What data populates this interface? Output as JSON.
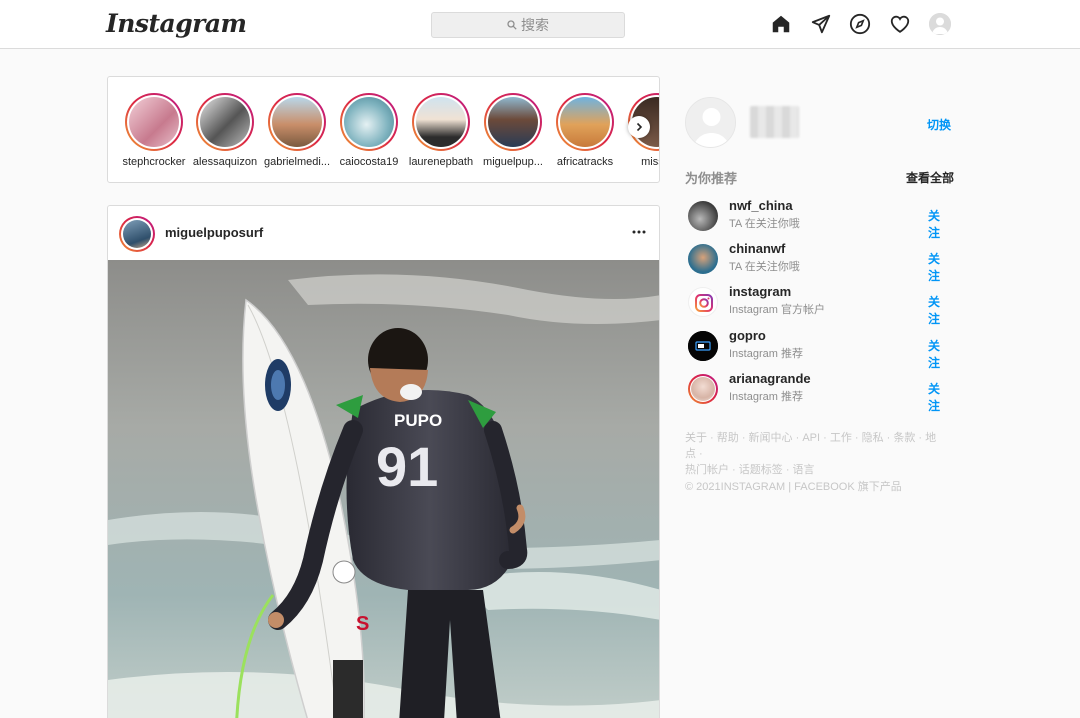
{
  "app": {
    "logo_text": "Instagram"
  },
  "search": {
    "placeholder": "搜索"
  },
  "nav": {
    "icons": [
      "home-icon",
      "direct-message-icon",
      "explore-compass-icon",
      "activity-heart-icon",
      "profile-avatar"
    ]
  },
  "stories": [
    {
      "username": "stephcrocker"
    },
    {
      "username": "alessaquizon"
    },
    {
      "username": "gabrielmedi..."
    },
    {
      "username": "caiocosta19"
    },
    {
      "username": "laurenepbath"
    },
    {
      "username": "miguelpup..."
    },
    {
      "username": "africatracks"
    },
    {
      "username": "missm"
    }
  ],
  "post": {
    "username": "miguelpuposurf",
    "jersey_name": "PUPO",
    "jersey_number": "91"
  },
  "sidebar": {
    "switch_label": "切换",
    "suggestions_title": "为你推荐",
    "see_all_label": "查看全部",
    "suggestions": [
      {
        "username": "nwf_china",
        "subtitle": "TA 在关注你哦",
        "follow_label": "关注"
      },
      {
        "username": "chinanwf",
        "subtitle": "TA 在关注你哦",
        "follow_label": "关注"
      },
      {
        "username": "instagram",
        "subtitle": "Instagram 官方帐户",
        "follow_label": "关注"
      },
      {
        "username": "gopro",
        "subtitle": "Instagram 推荐",
        "follow_label": "关注"
      },
      {
        "username": "arianagrande",
        "subtitle": "Instagram 推荐",
        "follow_label": "关注"
      }
    ],
    "footer_links_line1": "关于 · 帮助 · 新闻中心 · API · 工作 · 隐私 · 条款 · 地点 ·",
    "footer_links_line2": "热门帐户 · 话题标签 · 语言",
    "copyright": "© 2021INSTAGRAM | FACEBOOK 旗下产品"
  },
  "colors": {
    "accent_blue": "#0095f6",
    "border": "#dbdbdb",
    "background": "#fafafa",
    "story_ring": "#dc2743"
  }
}
